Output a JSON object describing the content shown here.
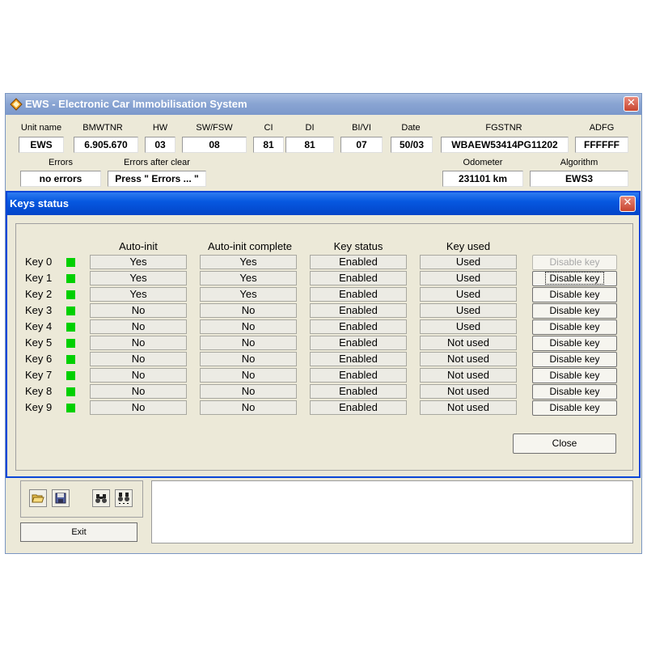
{
  "main": {
    "title": "EWS - Electronic Car Immobilisation System",
    "close": "✕",
    "labels": {
      "unit_name": "Unit name",
      "bmwtnr": "BMWTNR",
      "hw": "HW",
      "sw_fsw": "SW/FSW",
      "ci": "CI",
      "di": "DI",
      "bi_vi": "BI/VI",
      "date": "Date",
      "fgstnr": "FGSTNR",
      "adfg": "ADFG",
      "errors": "Errors",
      "errors_after_clear": "Errors after clear",
      "odometer": "Odometer",
      "algorithm": "Algorithm"
    },
    "values": {
      "unit_name": "EWS",
      "bmwtnr": "6.905.670",
      "hw": "03",
      "sw_fsw": "08",
      "ci": "81",
      "di": "81",
      "bi_vi": "07",
      "date": "50/03",
      "fgstnr": "WBAEW53414PG11202",
      "adfg": "FFFFFF",
      "errors": "no errors",
      "errors_after_clear": "Press \" Errors ... \"",
      "odometer": "231101 km",
      "algorithm": "EWS3"
    },
    "exit_label": "Exit"
  },
  "dialog": {
    "title": "Keys status",
    "close": "✕",
    "columns": [
      "Auto-init",
      "Auto-init complete",
      "Key status",
      "Key used"
    ],
    "rows": [
      {
        "key": "Key 0",
        "auto_init": "Yes",
        "auto_init_complete": "Yes",
        "status": "Enabled",
        "used": "Used",
        "button": "Disable key"
      },
      {
        "key": "Key 1",
        "auto_init": "Yes",
        "auto_init_complete": "Yes",
        "status": "Enabled",
        "used": "Used",
        "button": "Disable key"
      },
      {
        "key": "Key 2",
        "auto_init": "Yes",
        "auto_init_complete": "Yes",
        "status": "Enabled",
        "used": "Used",
        "button": "Disable key"
      },
      {
        "key": "Key 3",
        "auto_init": "No",
        "auto_init_complete": "No",
        "status": "Enabled",
        "used": "Used",
        "button": "Disable key"
      },
      {
        "key": "Key 4",
        "auto_init": "No",
        "auto_init_complete": "No",
        "status": "Enabled",
        "used": "Used",
        "button": "Disable key"
      },
      {
        "key": "Key 5",
        "auto_init": "No",
        "auto_init_complete": "No",
        "status": "Enabled",
        "used": "Not used",
        "button": "Disable key"
      },
      {
        "key": "Key 6",
        "auto_init": "No",
        "auto_init_complete": "No",
        "status": "Enabled",
        "used": "Not used",
        "button": "Disable key"
      },
      {
        "key": "Key 7",
        "auto_init": "No",
        "auto_init_complete": "No",
        "status": "Enabled",
        "used": "Not used",
        "button": "Disable key"
      },
      {
        "key": "Key 8",
        "auto_init": "No",
        "auto_init_complete": "No",
        "status": "Enabled",
        "used": "Not used",
        "button": "Disable key"
      },
      {
        "key": "Key 9",
        "auto_init": "No",
        "auto_init_complete": "No",
        "status": "Enabled",
        "used": "Not used",
        "button": "Disable key"
      }
    ],
    "close_label": "Close"
  },
  "colors": {
    "led_green": "#00d000",
    "dialog_titlebar": "#0658e0",
    "inactive_titlebar": "#8aa5d3"
  },
  "icons": [
    "open-folder-icon",
    "save-disk-icon",
    "binoculars-icon",
    "binoculars-search-icon"
  ]
}
